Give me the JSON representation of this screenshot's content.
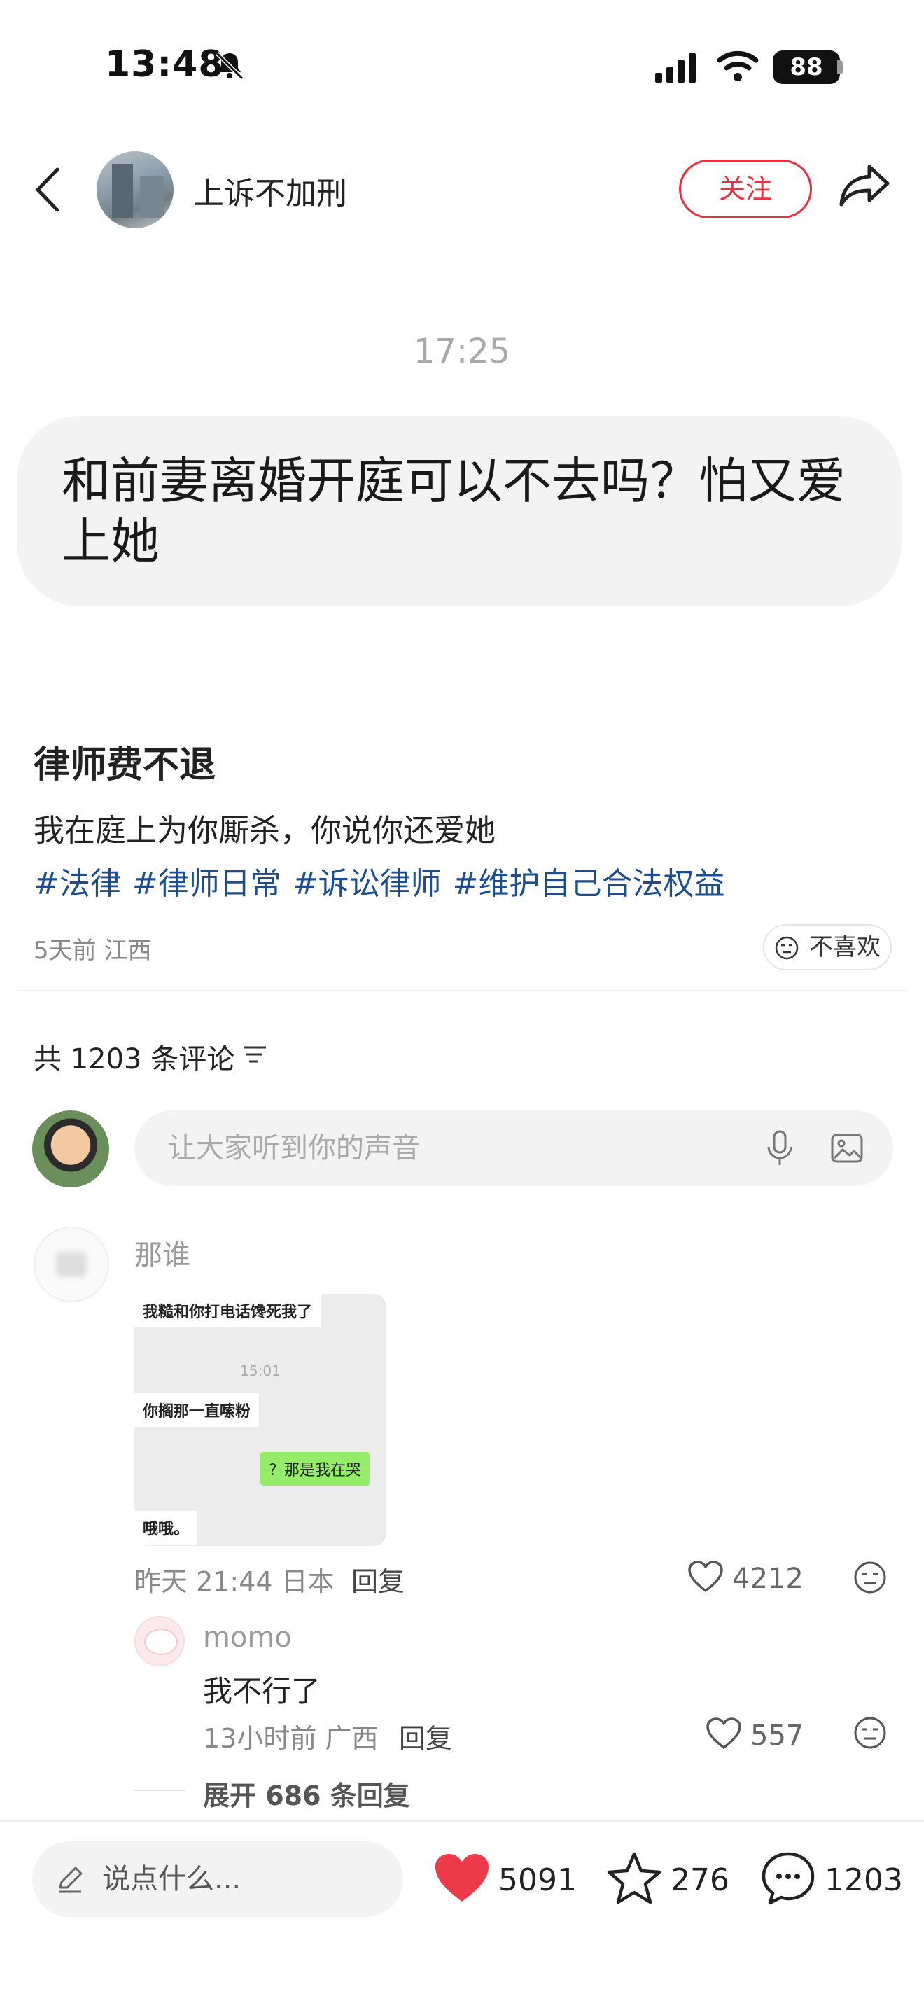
{
  "status_bar": {
    "time": "13:48",
    "battery": "88"
  },
  "header": {
    "author": "上诉不加刑",
    "follow_label": "关注"
  },
  "post": {
    "time": "17:25",
    "bubble_text": "和前妻离婚开庭可以不去吗？怕又爱上她",
    "title": "律师费不退",
    "body": "我在庭上为你厮杀，你说你还爱她",
    "tags": [
      "#法律",
      "#律师日常",
      "#诉讼律师",
      "#维护自己合法权益"
    ],
    "meta": "5天前 江西",
    "dislike_label": "不喜欢"
  },
  "comments": {
    "count_label": "共 1203 条评论",
    "input_placeholder": "让大家听到你的声音",
    "items": [
      {
        "name": "那谁",
        "image_chat": {
          "msg1": "我糙和你打电话馋死我了",
          "time": "15:01",
          "msg2": "你搁那一直嗦粉",
          "msg3": "？那是我在哭",
          "msg4": "哦哦。"
        },
        "meta": "昨天 21:44 日本",
        "reply_label": "回复",
        "likes": "4212",
        "reply": {
          "name": "momo",
          "text": "我不行了",
          "meta": "13小时前 广西",
          "reply_label": "回复",
          "likes": "557"
        },
        "expand_label": "展开 686 条回复"
      }
    ]
  },
  "bottom_bar": {
    "say_placeholder": "说点什么...",
    "likes": "5091",
    "stars": "276",
    "comments": "1203"
  },
  "colors": {
    "accent": "#e8303f",
    "tag": "#1b4d8f"
  }
}
